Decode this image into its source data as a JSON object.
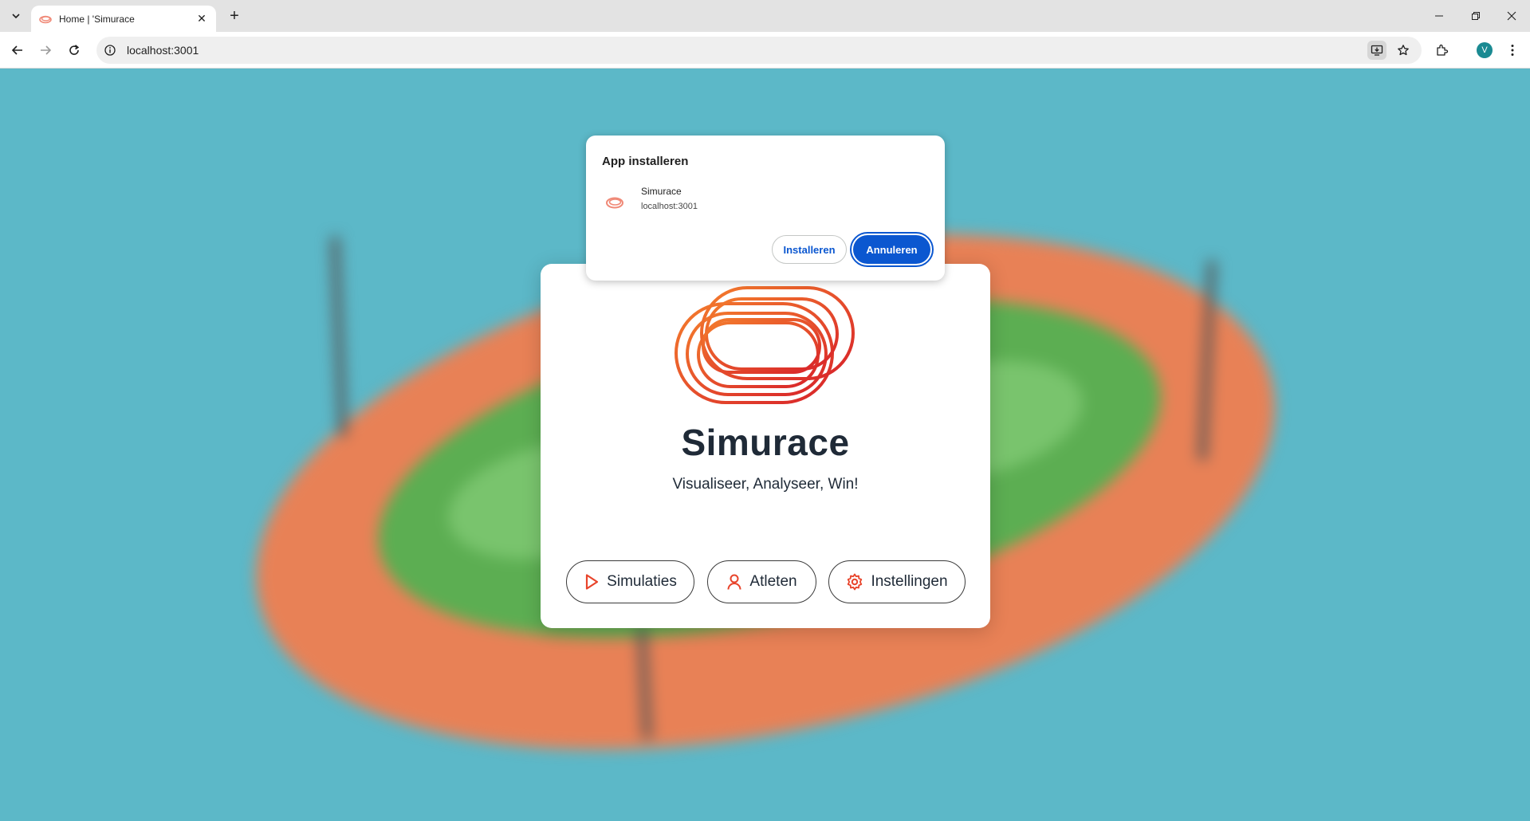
{
  "browser": {
    "tab": {
      "title": "Home | 'Simurace"
    },
    "address_bar": {
      "url": "localhost:3001"
    },
    "profile_initial": "V"
  },
  "install_popup": {
    "title": "App installeren",
    "app_name": "Simurace",
    "app_url": "localhost:3001",
    "install_label": "Installeren",
    "cancel_label": "Annuleren"
  },
  "hero": {
    "title": "Simurace",
    "tagline": "Visualiseer, Analyseer, Win!",
    "buttons": [
      {
        "label": "Simulaties",
        "icon": "play-icon"
      },
      {
        "label": "Atleten",
        "icon": "user-icon"
      },
      {
        "label": "Instellingen",
        "icon": "gear-icon"
      }
    ]
  },
  "colors": {
    "accent_orange": "#f07a2c",
    "accent_red": "#d9252a",
    "page_background": "#5cb8c8",
    "primary_blue": "#0b57d0"
  }
}
